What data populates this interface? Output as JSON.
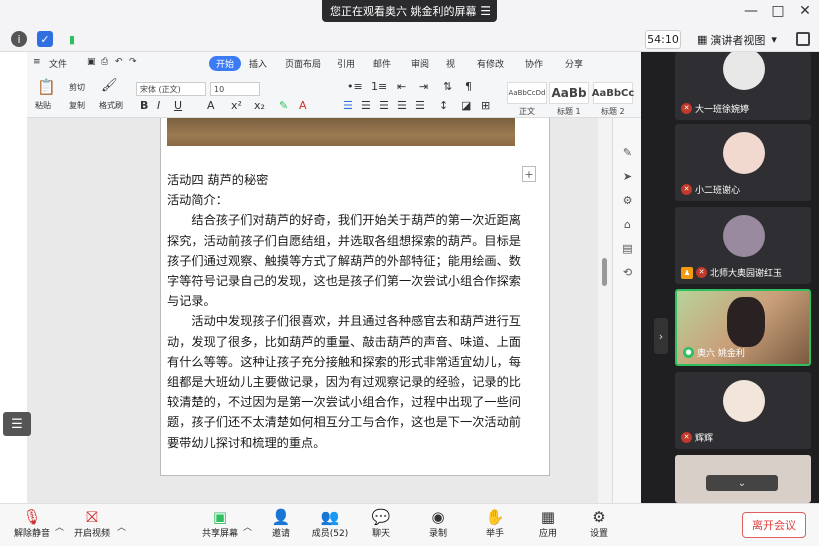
{
  "titlebar": {
    "sharing_text": "您正在观看奥六 姚金利的屏幕",
    "menu_icon": "menu-icon",
    "window_controls": [
      "—",
      "□",
      "✕"
    ]
  },
  "inforow": {
    "timer": "54:10",
    "view_mode": "演讲者视图",
    "view_caret": "▾"
  },
  "document": {
    "tabs": [
      "文件",
      "开始",
      "插入",
      "页面布局",
      "引用",
      "邮件",
      "审阅",
      "视"
    ],
    "active_tab": "开始",
    "right_tabs": [
      "有修改",
      "协作",
      "分享"
    ],
    "font_name": "宋体 (正文)",
    "font_size": "10",
    "tools_left": [
      "粘贴",
      "剪切",
      "复制",
      "格式刷"
    ],
    "styles": [
      {
        "preview": "AaBbCcDd",
        "label": "正文"
      },
      {
        "preview": "AaBb",
        "label": "标题 1"
      },
      {
        "preview": "AaBbCc",
        "label": "标题 2"
      }
    ],
    "heading": "活动四  葫芦的秘密",
    "intro_label": "活动简介：",
    "para1": "结合孩子们对葫芦的好奇，我们开始关于葫芦的第一次近距离探究，活动前孩子们自愿结组，并选取各组想探索的葫芦。目标是孩子们通过观察、触摸等方式了解葫芦的外部特征；能用绘画、数字等符号记录自己的发现，这也是孩子们第一次尝试小组合作探索与记录。",
    "para2": "活动中发现孩子们很喜欢，并且通过各种感官去和葫芦进行互动，发现了很多，比如葫芦的重量、敲击葫芦的声音、味道、上面有什么等等。这种让孩子充分接触和探索的形式非常适宜幼儿，每组都是大班幼儿主要做记录，因为有过观察记录的经验，记录的比较清楚的，不过因为是第一次尝试小组合作，过程中出现了一些问题，孩子们还不太清楚如何相互分工与合作，这也是下一次活动前要带幼儿探讨和梳理的重点。"
  },
  "participants": [
    {
      "name": "大一班徐婉婷",
      "muted": true,
      "host": false
    },
    {
      "name": "小二班谢心",
      "muted": true,
      "host": false
    },
    {
      "name": "北师大奥园谢红玉",
      "muted": true,
      "host": true
    },
    {
      "name": "奥六 姚金利",
      "muted": false,
      "host": false
    },
    {
      "name": "辉辉",
      "muted": true,
      "host": false
    }
  ],
  "participants_scroll": "⌄",
  "toolbar": {
    "mute": "解除静音",
    "video": "开启视频",
    "share": "共享屏幕",
    "invite": "邀请",
    "members": "成员(52)",
    "chat": "聊天",
    "record": "录制",
    "raise_hand": "举手",
    "apps": "应用",
    "settings": "设置",
    "leave": "离开会议"
  },
  "colors": {
    "accent": "#3b7cf5",
    "active_speaker": "#2fbf5f",
    "leave": "#e04040"
  }
}
